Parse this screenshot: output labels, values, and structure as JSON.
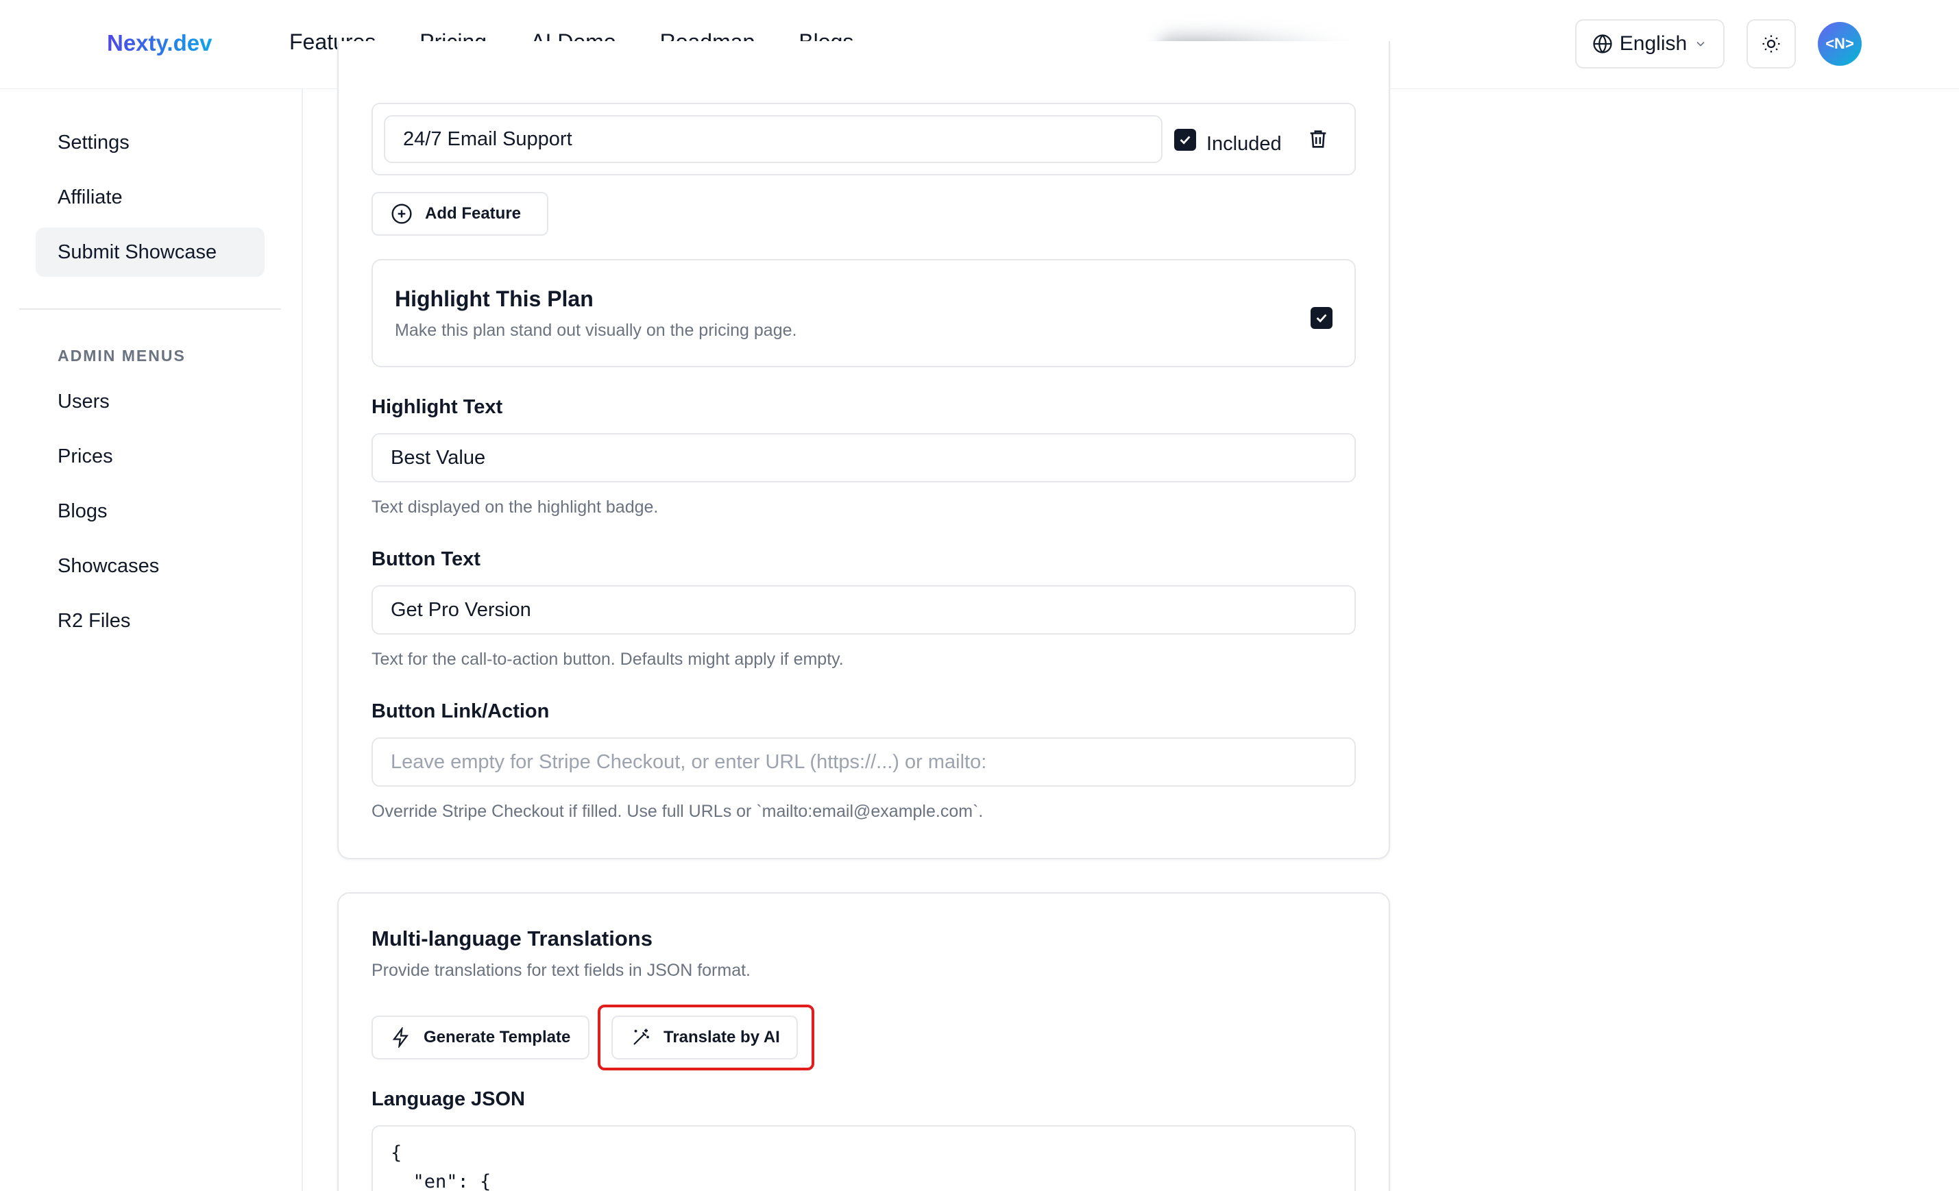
{
  "header": {
    "logo": "Nexty.dev",
    "nav": [
      "Features",
      "Pricing",
      "AI Demo",
      "Roadmap",
      "Blogs"
    ],
    "language": "English",
    "avatar_text": "<N>"
  },
  "sidebar": {
    "items": [
      "Settings",
      "Affiliate",
      "Submit Showcase"
    ],
    "admin_heading": "ADMIN MENUS",
    "admin_items": [
      "Users",
      "Prices",
      "Blogs",
      "Showcases",
      "R2 Files"
    ]
  },
  "features": {
    "feature_value": "24/7 Email Support",
    "included_label": "Included",
    "add_feature_label": "Add Feature"
  },
  "highlight": {
    "title": "Highlight This Plan",
    "description": "Make this plan stand out visually on the pricing page.",
    "highlight_text_label": "Highlight Text",
    "highlight_text_value": "Best Value",
    "highlight_text_help": "Text displayed on the highlight badge."
  },
  "button": {
    "text_label": "Button Text",
    "text_value": "Get Pro Version",
    "text_help": "Text for the call-to-action button. Defaults might apply if empty.",
    "link_label": "Button Link/Action",
    "link_placeholder": "Leave empty for Stripe Checkout, or enter URL (https://...) or mailto:",
    "link_help": "Override Stripe Checkout if filled. Use full URLs or `mailto:email@example.com`."
  },
  "translations": {
    "title": "Multi-language Translations",
    "description": "Provide translations for text fields in JSON format.",
    "generate_template_label": "Generate Template",
    "translate_ai_label": "Translate by AI",
    "json_label": "Language JSON",
    "json_line1": "{",
    "json_line2": "  \"en\": {"
  },
  "colors": {
    "accent_outline": "#e11d1d",
    "logo_gradient_start": "#4f46e5",
    "logo_gradient_end": "#0ea5e9"
  }
}
